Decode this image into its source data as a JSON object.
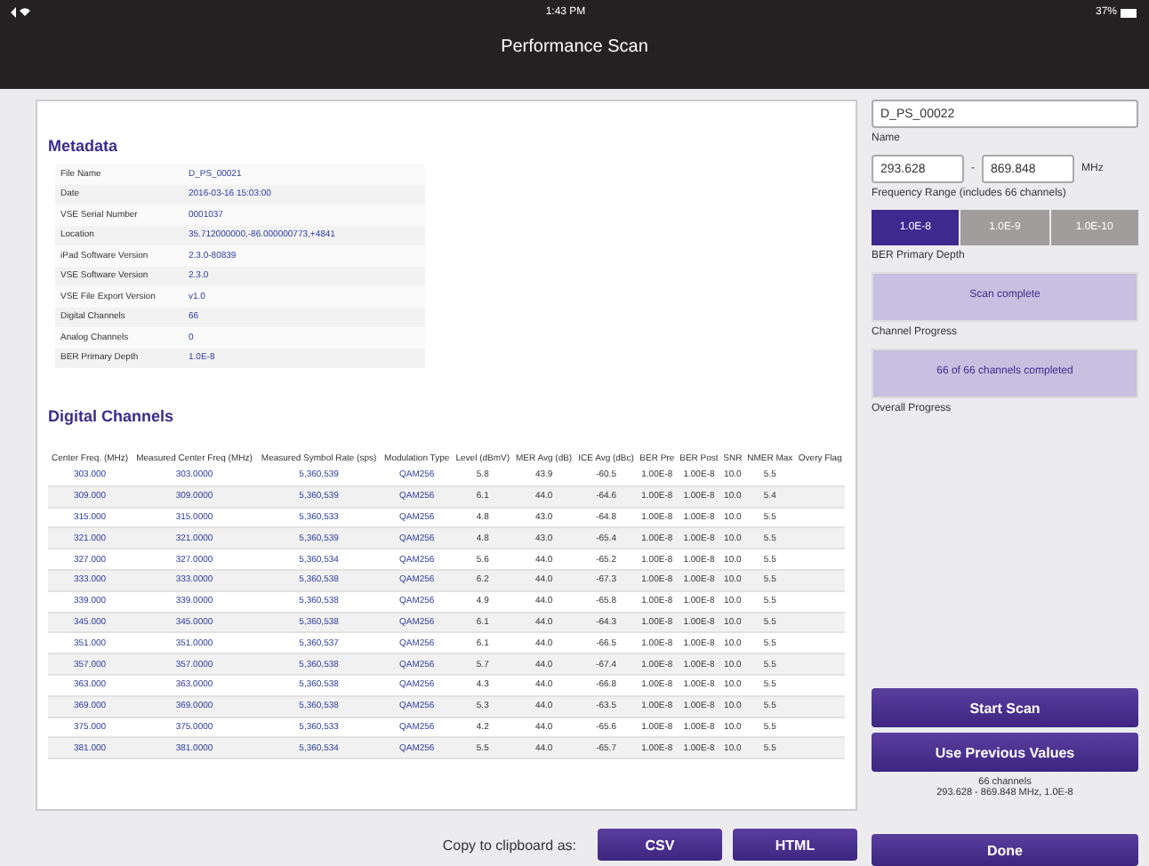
{
  "status_bar": {
    "time": "1:43 PM",
    "battery": "37%"
  },
  "window": {
    "title": "Performance Scan"
  },
  "metadata": {
    "title": "Metadata",
    "rows": [
      {
        "label": "File Name",
        "value": "D_PS_00021"
      },
      {
        "label": "Date",
        "value": "2016-03-16 15:03:00"
      },
      {
        "label": "VSE Serial Number",
        "value": "0001037"
      },
      {
        "label": "Location",
        "value": "35.712000000,-86.000000773,+4841"
      },
      {
        "label": "iPad Software Version",
        "value": "2.3.0-80839"
      },
      {
        "label": "VSE Software Version",
        "value": "2.3.0"
      },
      {
        "label": "VSE File Export Version",
        "value": "v1.0"
      },
      {
        "label": "Digital Channels",
        "value": "66"
      },
      {
        "label": "Analog Channels",
        "value": "0"
      },
      {
        "label": "BER Primary Depth",
        "value": "1.0E-8"
      }
    ]
  },
  "digital_channels": {
    "title": "Digital Channels",
    "columns": [
      "Center Freq. (MHz)",
      "Measured Center Freq (MHz)",
      "Measured Symbol Rate (sps)",
      "Modulation Type",
      "Level (dBmV)",
      "MER Avg (dB)",
      "ICE Avg (dBc)",
      "BER Pre",
      "BER Post",
      "SNR",
      "NMER Max",
      "Overy Flag"
    ],
    "rows": [
      [
        "303.000",
        "303.0000",
        "5,360,539",
        "QAM256",
        "5.8",
        "43.9",
        "-60.5",
        "1.00E-8",
        "1.00E-8",
        "10.0",
        "5.5"
      ],
      [
        "309.000",
        "309.0000",
        "5,360,539",
        "QAM256",
        "6.1",
        "44.0",
        "-64.6",
        "1.00E-8",
        "1.00E-8",
        "10.0",
        "5.4"
      ],
      [
        "315.000",
        "315.0000",
        "5,360,533",
        "QAM256",
        "4.8",
        "43.0",
        "-64.8",
        "1.00E-8",
        "1.00E-8",
        "10.0",
        "5.5"
      ],
      [
        "321.000",
        "321.0000",
        "5,360,539",
        "QAM256",
        "4.8",
        "43.0",
        "-65.4",
        "1.00E-8",
        "1.00E-8",
        "10.0",
        "5.5"
      ],
      [
        "327.000",
        "327.0000",
        "5,360,534",
        "QAM256",
        "5.6",
        "44.0",
        "-65.2",
        "1.00E-8",
        "1.00E-8",
        "10.0",
        "5.5"
      ],
      [
        "333.000",
        "333.0000",
        "5,360,538",
        "QAM256",
        "6.2",
        "44.0",
        "-67.3",
        "1.00E-8",
        "1.00E-8",
        "10.0",
        "5.5"
      ],
      [
        "339.000",
        "339.0000",
        "5,360,538",
        "QAM256",
        "4.9",
        "44.0",
        "-65.8",
        "1.00E-8",
        "1.00E-8",
        "10.0",
        "5.5"
      ],
      [
        "345.000",
        "345.0000",
        "5,360,538",
        "QAM256",
        "6.1",
        "44.0",
        "-64.3",
        "1.00E-8",
        "1.00E-8",
        "10.0",
        "5.5"
      ],
      [
        "351.000",
        "351.0000",
        "5,360,537",
        "QAM256",
        "6.1",
        "44.0",
        "-66.5",
        "1.00E-8",
        "1.00E-8",
        "10.0",
        "5.5"
      ],
      [
        "357.000",
        "357.0000",
        "5,360,538",
        "QAM256",
        "5.7",
        "44.0",
        "-67.4",
        "1.00E-8",
        "1.00E-8",
        "10.0",
        "5.5"
      ],
      [
        "363.000",
        "363.0000",
        "5,360,538",
        "QAM256",
        "4.3",
        "44.0",
        "-66.8",
        "1.00E-8",
        "1.00E-8",
        "10.0",
        "5.5"
      ],
      [
        "369.000",
        "369.0000",
        "5,360,538",
        "QAM256",
        "5.3",
        "44.0",
        "-63.5",
        "1.00E-8",
        "1.00E-8",
        "10.0",
        "5.5"
      ],
      [
        "375.000",
        "375.0000",
        "5,360,533",
        "QAM256",
        "4.2",
        "44.0",
        "-65.6",
        "1.00E-8",
        "1.00E-8",
        "10.0",
        "5.5"
      ],
      [
        "381.000",
        "381.0000",
        "5,360,534",
        "QAM256",
        "5.5",
        "44.0",
        "-65.7",
        "1.00E-8",
        "1.00E-8",
        "10.0",
        "5.5"
      ]
    ]
  },
  "copy_bar": {
    "label": "Copy to clipboard as:",
    "buttons": [
      "CSV",
      "HTML"
    ]
  },
  "scan_panel": {
    "name_value": "D_PS_00022",
    "name_label": "Name",
    "range_from": "293.628",
    "range_sep": "-",
    "range_to": "869.848",
    "range_unit": "MHz",
    "range_label": "Frequency Range (includes 66 channels)",
    "depth_options": [
      {
        "label": "1.0E-8",
        "selected": true
      },
      {
        "label": "1.0E-9",
        "selected": false
      },
      {
        "label": "1.0E-10",
        "selected": false
      }
    ],
    "depth_label": "BER Primary Depth",
    "progress": [
      {
        "text": "Scan complete",
        "level": 1,
        "label": "Channel Progress"
      },
      {
        "text": "66 of 66 channels completed",
        "level": 1,
        "label": "Overall Progress"
      }
    ],
    "buttons": [
      "Start Scan",
      "Use Previous Values"
    ],
    "summary": [
      "66 channels",
      "293.628 - 869.848 MHz, 1.0E-8"
    ],
    "done": "Done"
  }
}
